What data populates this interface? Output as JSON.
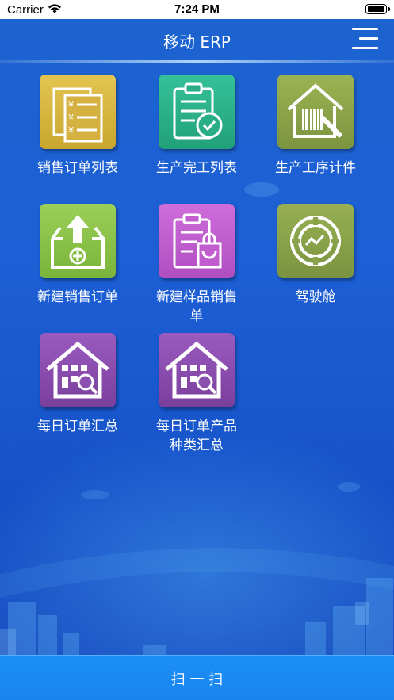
{
  "status_bar": {
    "carrier": "Carrier",
    "time": "7:24 PM"
  },
  "nav": {
    "title": "移动 ERP",
    "menu_icon": "hamburger-menu-icon"
  },
  "modules": [
    {
      "label": "销售订单列表",
      "icon": "sales-order-list-icon",
      "color": "#d9b83e"
    },
    {
      "label": "生产完工列表",
      "icon": "production-complete-list-icon",
      "color": "#2fb48a"
    },
    {
      "label": "生产工序计件",
      "icon": "process-piecework-icon",
      "color": "#8fa64a"
    },
    {
      "label": "新建销售订单",
      "icon": "new-sales-order-icon",
      "color": "#8cc348"
    },
    {
      "label": "新建样品销售单",
      "icon": "new-sample-sales-icon",
      "color": "#c25dd0"
    },
    {
      "label": "驾驶舱",
      "icon": "cockpit-icon",
      "color": "#8aa348"
    },
    {
      "label": "每日订单汇总",
      "icon": "daily-order-summary-icon",
      "color": "#8b4fae"
    },
    {
      "label": "每日订单产品种类汇总",
      "icon": "daily-product-category-summary-icon",
      "color": "#8b4fae"
    }
  ],
  "scan_button": {
    "label": "扫 一 扫"
  }
}
